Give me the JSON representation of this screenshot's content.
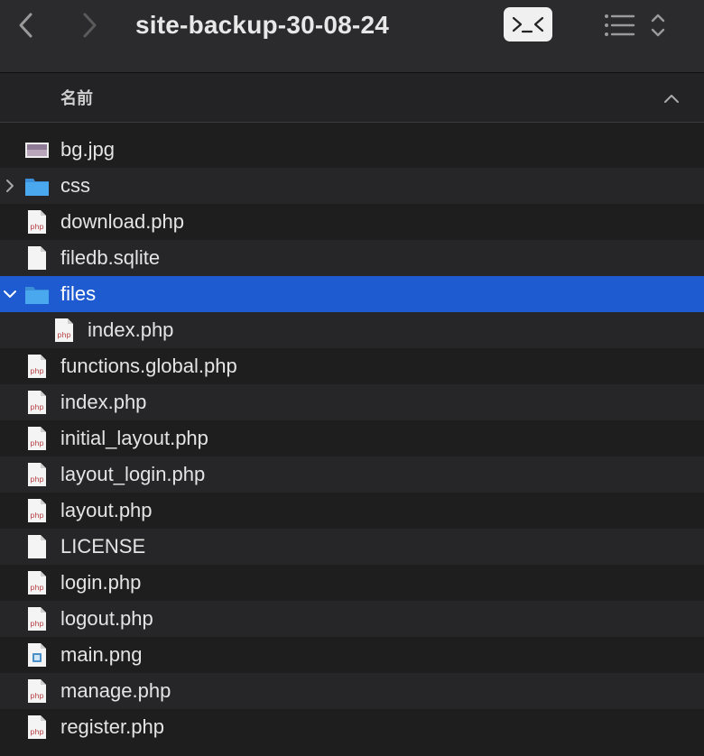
{
  "window": {
    "title": "site-backup-30-08-24"
  },
  "header": {
    "name_column": "名前"
  },
  "files": [
    {
      "name": "bg.jpg",
      "kind": "image"
    },
    {
      "name": "css",
      "kind": "folder",
      "disclosure": "collapsed"
    },
    {
      "name": "download.php",
      "kind": "php"
    },
    {
      "name": "filedb.sqlite",
      "kind": "doc"
    },
    {
      "name": "files",
      "kind": "folder",
      "disclosure": "expanded",
      "selected": true
    },
    {
      "name": "index.php",
      "kind": "php",
      "child": true
    },
    {
      "name": "functions.global.php",
      "kind": "php"
    },
    {
      "name": "index.php",
      "kind": "php"
    },
    {
      "name": "initial_layout.php",
      "kind": "php"
    },
    {
      "name": "layout_login.php",
      "kind": "php"
    },
    {
      "name": "layout.php",
      "kind": "php"
    },
    {
      "name": "LICENSE",
      "kind": "doc"
    },
    {
      "name": "login.php",
      "kind": "php"
    },
    {
      "name": "logout.php",
      "kind": "php"
    },
    {
      "name": "main.png",
      "kind": "png"
    },
    {
      "name": "manage.php",
      "kind": "php"
    },
    {
      "name": "register.php",
      "kind": "php"
    }
  ],
  "icons": {
    "back": "chevron-left-icon",
    "forward": "chevron-right-icon",
    "terminal": "terminal-icon",
    "list_view": "list-view-icon",
    "sort": "chevron-up-icon"
  },
  "colors": {
    "selection": "#1f5bd0",
    "folder": "#4aa3e8",
    "php_badge": "#b33a3a"
  }
}
